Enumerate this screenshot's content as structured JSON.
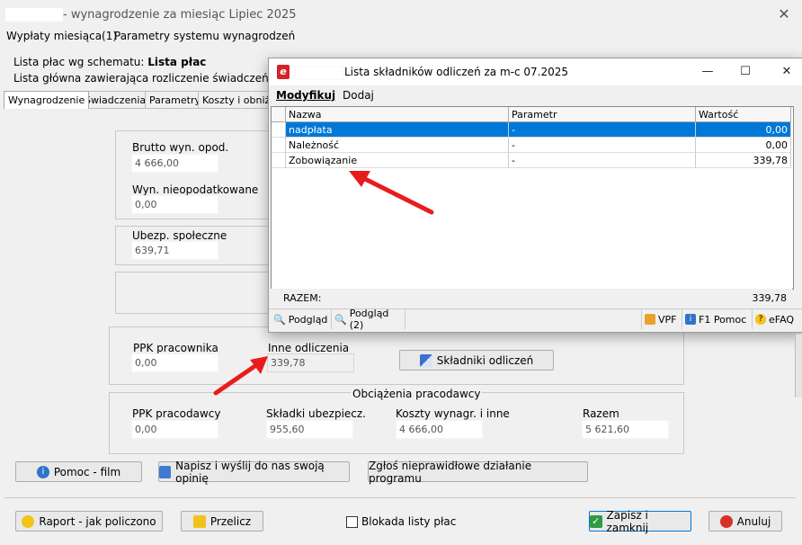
{
  "window": {
    "title": "- wynagrodzenie za miesiąc Lipiec 2025",
    "close_glyph": "✕"
  },
  "menu": {
    "item1": "Wypłaty miesiąca(1)",
    "item2": "Parametry systemu wynagrodzeń"
  },
  "info": {
    "line1_label": "Lista płac wg schematu:",
    "line1_value": "Lista płac",
    "line2": "Lista główna zawierająca rozliczenie świadczeń"
  },
  "tabs": [
    "Wynagrodzenie",
    "Świadczenia",
    "Parametry",
    "Koszty i obniżen"
  ],
  "form": {
    "brutto_label": "Brutto wyn. opod.",
    "brutto_value": "4 666,00",
    "nieopod_label": "Wyn. nieopodatkowane",
    "nieopod_value": "0,00",
    "ubezp_label": "Ubezp. społeczne",
    "ubezp_value": "639,71",
    "ppk_prac_label": "PPK pracownika",
    "ppk_prac_value": "0,00",
    "inne_label": "Inne odliczenia",
    "inne_value": "339,78",
    "skladniki_button": "Składniki odliczeń",
    "obciazenia_title": "Obciążenia pracodawcy",
    "ppk_pracodawcy_label": "PPK pracodawcy",
    "ppk_pracodawcy_value": "0,00",
    "skladki_label": "Składki ubezpiecz.",
    "skladki_value": "955,60",
    "koszty_label": "Koszty wynagr. i inne",
    "koszty_value": "4 666,00",
    "razem_label": "Razem",
    "razem_value": "5 621,60"
  },
  "buttons": {
    "pomoc_film": "Pomoc - film",
    "napisz": "Napisz i wyślij do nas swoją opinię",
    "zglos": "Zgłoś nieprawidłowe działanie programu",
    "raport": "Raport - jak policzono",
    "przelicz": "Przelicz",
    "blokada": "Blokada listy płac",
    "zapisz": "Zapisz i zamknij",
    "anuluj": "Anuluj"
  },
  "dialog": {
    "title": "Lista składników odliczeń za m-c 07.2025",
    "app_glyph": "e",
    "menu_modyfikuj": "Modyfikuj",
    "menu_dodaj": "Dodaj",
    "columns": [
      "Nazwa",
      "Parametr",
      "Wartość"
    ],
    "rows": [
      {
        "name": "nadpłata",
        "param": "-",
        "value": "0,00",
        "selected": true
      },
      {
        "name": "Należność",
        "param": "-",
        "value": "0,00",
        "selected": false
      },
      {
        "name": "Zobowiązanie",
        "param": "-",
        "value": "339,78",
        "selected": false
      }
    ],
    "sum_label": "RAZEM:",
    "sum_value": "339,78",
    "toolbar": {
      "podglad": "Podgląd",
      "podglad2": "Podgląd (2)",
      "vpf": "VPF",
      "f1": "F1 Pomoc",
      "efaq": "eFAQ"
    },
    "minimize_glyph": "—",
    "maximize_glyph": "☐",
    "close_glyph": "✕"
  },
  "colors": {
    "selection": "#0078d7",
    "arrow": "#e81c1c",
    "app_icon": "#d2232a"
  }
}
